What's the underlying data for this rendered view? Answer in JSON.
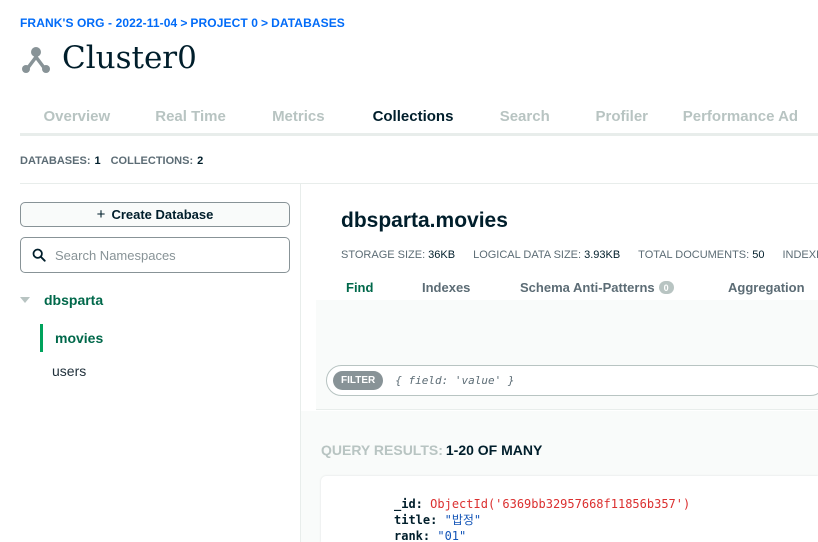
{
  "breadcrumb": {
    "org": "FRANK'S ORG - 2022-11-04",
    "sep": ">",
    "project": "PROJECT 0",
    "section": "DATABASES"
  },
  "cluster": {
    "name": "Cluster0",
    "icon": "cluster-icon"
  },
  "tabs": [
    {
      "label": "Overview",
      "active": false
    },
    {
      "label": "Real Time",
      "active": false
    },
    {
      "label": "Metrics",
      "active": false
    },
    {
      "label": "Collections",
      "active": true
    },
    {
      "label": "Search",
      "active": false
    },
    {
      "label": "Profiler",
      "active": false
    },
    {
      "label": "Performance Ad",
      "active": false
    }
  ],
  "stats": {
    "databases_label": "DATABASES:",
    "databases_value": "1",
    "collections_label": "COLLECTIONS:",
    "collections_value": "2"
  },
  "sidebar": {
    "create_label": "Create Database",
    "search_placeholder": "Search Namespaces",
    "database": "dbsparta",
    "collections": [
      "movies",
      "users"
    ],
    "active_collection": "movies"
  },
  "namespace": {
    "title": "dbsparta.movies",
    "storage_label": "STORAGE SIZE:",
    "storage_value": "36KB",
    "logical_label": "LOGICAL DATA SIZE:",
    "logical_value": "3.93KB",
    "docs_label": "TOTAL DOCUMENTS:",
    "docs_value": "50",
    "indexes_label": "INDEXE"
  },
  "subtabs": {
    "find": "Find",
    "indexes": "Indexes",
    "schema": "Schema Anti-Patterns",
    "schema_badge": "0",
    "aggregation": "Aggregation"
  },
  "filter": {
    "label": "FILTER",
    "placeholder": "{ field: 'value' }"
  },
  "results": {
    "label": "QUERY RESULTS:",
    "count": "1-20 OF MANY"
  },
  "document": {
    "id_key": "_id:",
    "id_value": "ObjectId('6369bb32957668f11856b357')",
    "title_key": "title:",
    "title_value": "\"밥정\"",
    "rank_key": "rank:",
    "rank_value": "\"01\""
  },
  "colors": {
    "accent_green": "#00684a",
    "link_blue": "#016bf8",
    "muted": "#b8c4c2"
  }
}
